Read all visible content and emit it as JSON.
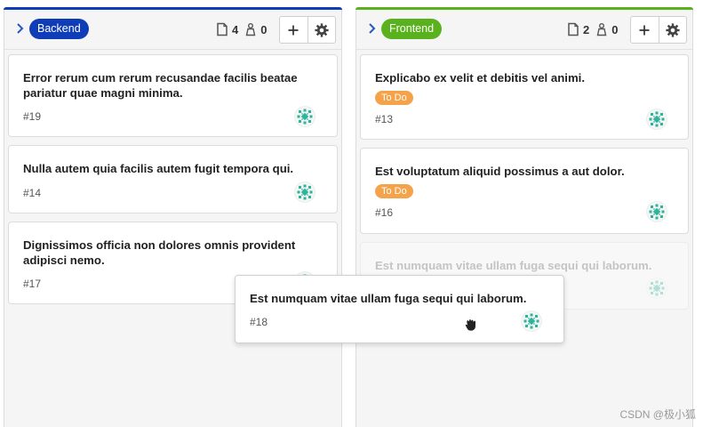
{
  "colors": {
    "backend_accent": "#0f3db8",
    "frontend_accent": "#59b21d",
    "todo_badge": "#f5a34a"
  },
  "columns": [
    {
      "label": "Backend",
      "issue_count": "4",
      "assignee_count": "0",
      "cards": [
        {
          "title": "Error rerum cum rerum recusandae facilis beatae pariatur quae magni minima.",
          "number": "#19"
        },
        {
          "title": "Nulla autem quia facilis autem fugit tempora qui.",
          "number": "#14"
        },
        {
          "title": "Dignissimos officia non dolores omnis provident adipisci nemo.",
          "number": "#17"
        }
      ]
    },
    {
      "label": "Frontend",
      "issue_count": "2",
      "assignee_count": "0",
      "cards": [
        {
          "title": "Explicabo ex velit et debitis vel animi.",
          "badge": "To Do",
          "number": "#13"
        },
        {
          "title": "Est voluptatum aliquid possimus a aut dolor.",
          "badge": "To Do",
          "number": "#16"
        },
        {
          "title": "Est numquam vitae ullam fuga sequi qui laborum.",
          "placeholder": true
        }
      ]
    }
  ],
  "dragging_card": {
    "title": "Est numquam vitae ullam fuga sequi qui laborum.",
    "number": "#18"
  },
  "icons": {
    "expand": "chevron-right-icon",
    "issues": "issues-icon",
    "assignees": "weight-icon",
    "add": "plus-icon",
    "settings": "gear-icon",
    "avatar": "identicon-avatar",
    "cursor": "grab-hand-icon"
  },
  "watermark": "CSDN @极小狐"
}
